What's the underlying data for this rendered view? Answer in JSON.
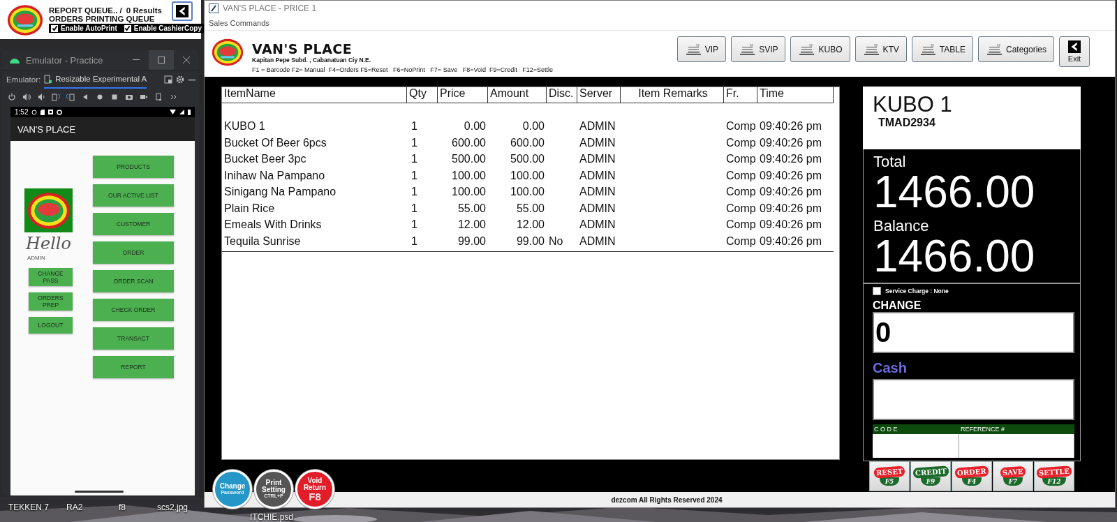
{
  "report_queue": {
    "title": "REPORT QUEUE.. /",
    "results": "0 Results",
    "subtitle": "ORDERS PRINTING QUEUE",
    "options": [
      {
        "label": "Enable AutoPrint",
        "checked": true
      },
      {
        "label": "Enable CashierCopy",
        "checked": true
      }
    ]
  },
  "emulator": {
    "title": "Emulator - Practice",
    "label": "Emulator:",
    "tab": "Resizable Experimental A",
    "phone": {
      "time": "1:52",
      "app_title": "VAN'S PLACE",
      "greeting": "Hello",
      "user": "ADMIN",
      "side_buttons": [
        "CHANGE PASS",
        "ORDERS PREP",
        "LOGOUT"
      ],
      "menu_buttons": [
        "PRODUCTS",
        "OUR ACTIVE LIST",
        "CUSTOMER",
        "ORDER",
        "ORDER SCAN",
        "CHECK ORDER",
        "TRANSACT",
        "REPORT"
      ]
    }
  },
  "main_window": {
    "title": "VAN'S PLACE - PRICE 1",
    "menu": [
      "Sales Commands"
    ],
    "store": {
      "name": "VAN'S PLACE",
      "address": "Kapitan Pepe Subd. , Cabanatuan Ciy N.E.",
      "shortcuts": "F1 = Barcode F2= Manual  F4=Orders F5=Reset   F6=NoPrint   F7= Save   F8=Void  F9=Credit   F12=Settle"
    },
    "category_buttons": [
      "VIP",
      "SVIP",
      "KUBO",
      "KTV",
      "TABLE",
      "Categories"
    ],
    "exit_button": "Exit",
    "table": {
      "columns": [
        "ItemName",
        "Qty",
        "Price",
        "Amount",
        "Disc.",
        "Server",
        "Item Remarks",
        "Fr.",
        "Time"
      ],
      "rows": [
        {
          "item": "KUBO 1",
          "qty": "1",
          "price": "0.00",
          "amount": "0.00",
          "server": "ADMIN",
          "fr": "Comp",
          "time": "09:40:26 pm"
        },
        {
          "item": "Bucket Of Beer 6pcs",
          "qty": "1",
          "price": "600.00",
          "amount": "600.00",
          "server": "ADMIN",
          "fr": "Comp",
          "time": "09:40:26 pm"
        },
        {
          "item": "Bucket Beer 3pc",
          "qty": "1",
          "price": "500.00",
          "amount": "500.00",
          "server": "ADMIN",
          "fr": "Comp",
          "time": "09:40:26 pm"
        },
        {
          "item": "Inihaw Na Pampano",
          "qty": "1",
          "price": "100.00",
          "amount": "100.00",
          "server": "ADMIN",
          "fr": "Comp",
          "time": "09:40:26 pm"
        },
        {
          "item": "Sinigang Na Pampano",
          "qty": "1",
          "price": "100.00",
          "amount": "100.00",
          "server": "ADMIN",
          "fr": "Comp",
          "time": "09:40:26 pm"
        },
        {
          "item": "Plain Rice",
          "qty": "1",
          "price": "55.00",
          "amount": "55.00",
          "server": "ADMIN",
          "fr": "Comp",
          "time": "09:40:26 pm"
        },
        {
          "item": "Emeals With Drinks",
          "qty": "1",
          "price": "12.00",
          "amount": "12.00",
          "server": "ADMIN",
          "fr": "Comp",
          "time": "09:40:26 pm"
        },
        {
          "item": "Tequila Sunrise",
          "qty": "1",
          "price": "99.00",
          "amount": "99.00",
          "disc": "No",
          "server": "ADMIN",
          "fr": "Comp",
          "time": "09:40:26 pm"
        }
      ]
    },
    "summary": {
      "table_name": "KUBO 1",
      "code": "TMAD2934",
      "total_label": "Total",
      "total": "1466.00",
      "balance_label": "Balance",
      "balance": "1466.00",
      "service_charge": {
        "label": "Service Charge : None",
        "checked": false
      },
      "change_label": "CHANGE",
      "change": "0",
      "cash_label": "Cash",
      "code_label": "C O D E",
      "reference_label": "REFERENCE #"
    },
    "action_buttons": [
      {
        "label": "RESET",
        "key": "F5",
        "color": "#e8202a"
      },
      {
        "label": "CREDIT",
        "key": "F9",
        "color": "#1b6a2b"
      },
      {
        "label": "ORDER",
        "key": "F4",
        "color": "#e8202a"
      },
      {
        "label": "SAVE",
        "key": "F7",
        "color": "#e8202a"
      },
      {
        "label": "SETTLE",
        "key": "F12",
        "color": "#e8202a"
      }
    ],
    "round_buttons": [
      {
        "label": "Change",
        "sub": "Password",
        "color": "#2596c8"
      },
      {
        "label": "Print Setting",
        "sub": "CTRL+P",
        "color": "#555555"
      },
      {
        "label": "Void Return",
        "sub": "F8",
        "color": "#e11d2a"
      }
    ],
    "footer": "dezcom All Rights Reserved 2024"
  },
  "desktop_icons": [
    "TEKKEN 7",
    "RA2",
    "f8",
    "scs2.jpg",
    "ITCHIE.psd"
  ]
}
